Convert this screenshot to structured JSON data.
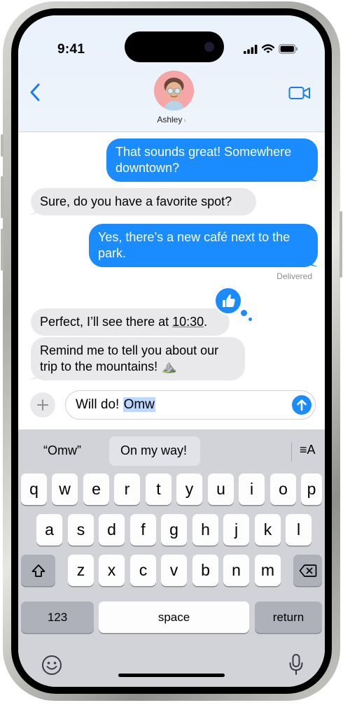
{
  "status_bar": {
    "time": "9:41"
  },
  "header": {
    "contact_name": "Ashley",
    "chevron": "›",
    "back_icon": "chevron-left-icon",
    "video_icon": "video-camera-icon"
  },
  "messages": [
    {
      "id": "m1",
      "direction": "outgoing",
      "lines": [
        "That sounds great! Somewhere",
        "downtown?"
      ]
    },
    {
      "id": "m2",
      "direction": "incoming",
      "lines": [
        "Sure, do you have a favorite spot?"
      ]
    },
    {
      "id": "m3",
      "direction": "outgoing",
      "lines": [
        "Yes, there’s a new café next to the",
        "park."
      ]
    },
    {
      "id": "m4",
      "direction": "incoming",
      "text_before": "Perfect, I’ll see there at ",
      "time_link": "10:30",
      "text_after": "."
    },
    {
      "id": "m5",
      "direction": "incoming",
      "lines": [
        "Remind me to tell you about our",
        "trip to the mountains! ⛰️"
      ]
    }
  ],
  "delivered_label": "Delivered",
  "tapback_icon": "thumbs-up-icon",
  "composer": {
    "text_plain": "Will do! ",
    "text_selected": "Omw",
    "plus_icon": "plus-icon",
    "send_icon": "arrow-up-icon"
  },
  "keyboard": {
    "predictions": [
      "“Omw”",
      "On my way!"
    ],
    "format_label": "≡A",
    "row1": [
      "q",
      "w",
      "e",
      "r",
      "t",
      "y",
      "u",
      "i",
      "o",
      "p"
    ],
    "row2": [
      "a",
      "s",
      "d",
      "f",
      "g",
      "h",
      "j",
      "k",
      "l"
    ],
    "row3": [
      "z",
      "x",
      "c",
      "v",
      "b",
      "n",
      "m"
    ],
    "numbers_label": "123",
    "space_label": "space",
    "return_label": "return",
    "shift_icon": "shift-icon",
    "delete_icon": "delete-icon",
    "emoji_icon": "emoji-icon",
    "mic_icon": "microphone-icon"
  },
  "colors": {
    "accent": "#1a8cff",
    "incoming_bubble": "#e9e9eb",
    "keyboard_bg": "#d1d3d9"
  }
}
